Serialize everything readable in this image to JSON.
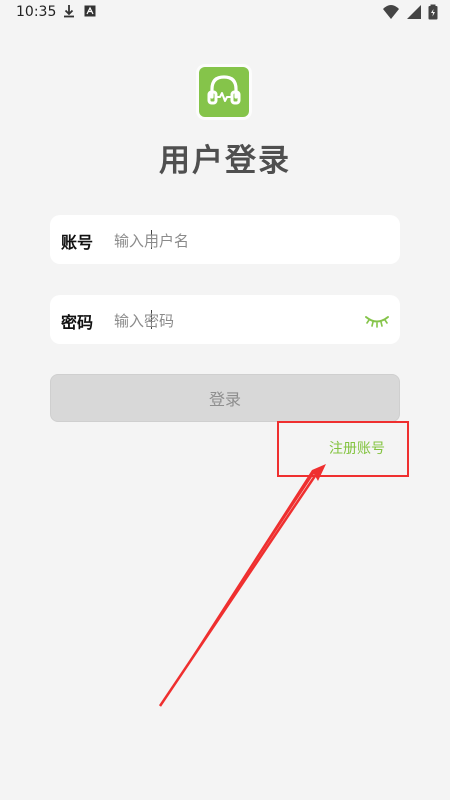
{
  "status_bar": {
    "time": "10:35"
  },
  "page_title": "用户登录",
  "username_field": {
    "label": "账号",
    "placeholder": "输入用户名"
  },
  "password_field": {
    "label": "密码",
    "placeholder": "输入密码"
  },
  "login_button": {
    "label": "登录"
  },
  "register_link": {
    "label": "注册账号"
  },
  "colors": {
    "brand_green": "#85c44a",
    "register_green": "#83c33f",
    "annotation_red": "#ef2f2f",
    "login_button_bg": "#d8d8d8"
  },
  "icons": {
    "status_download": "download-icon",
    "status_a": "a-icon",
    "wifi": "wifi-icon",
    "signal": "signal-icon",
    "battery": "battery-icon",
    "logo": "headphones-icon",
    "password_toggle": "eye-closed-icon"
  }
}
